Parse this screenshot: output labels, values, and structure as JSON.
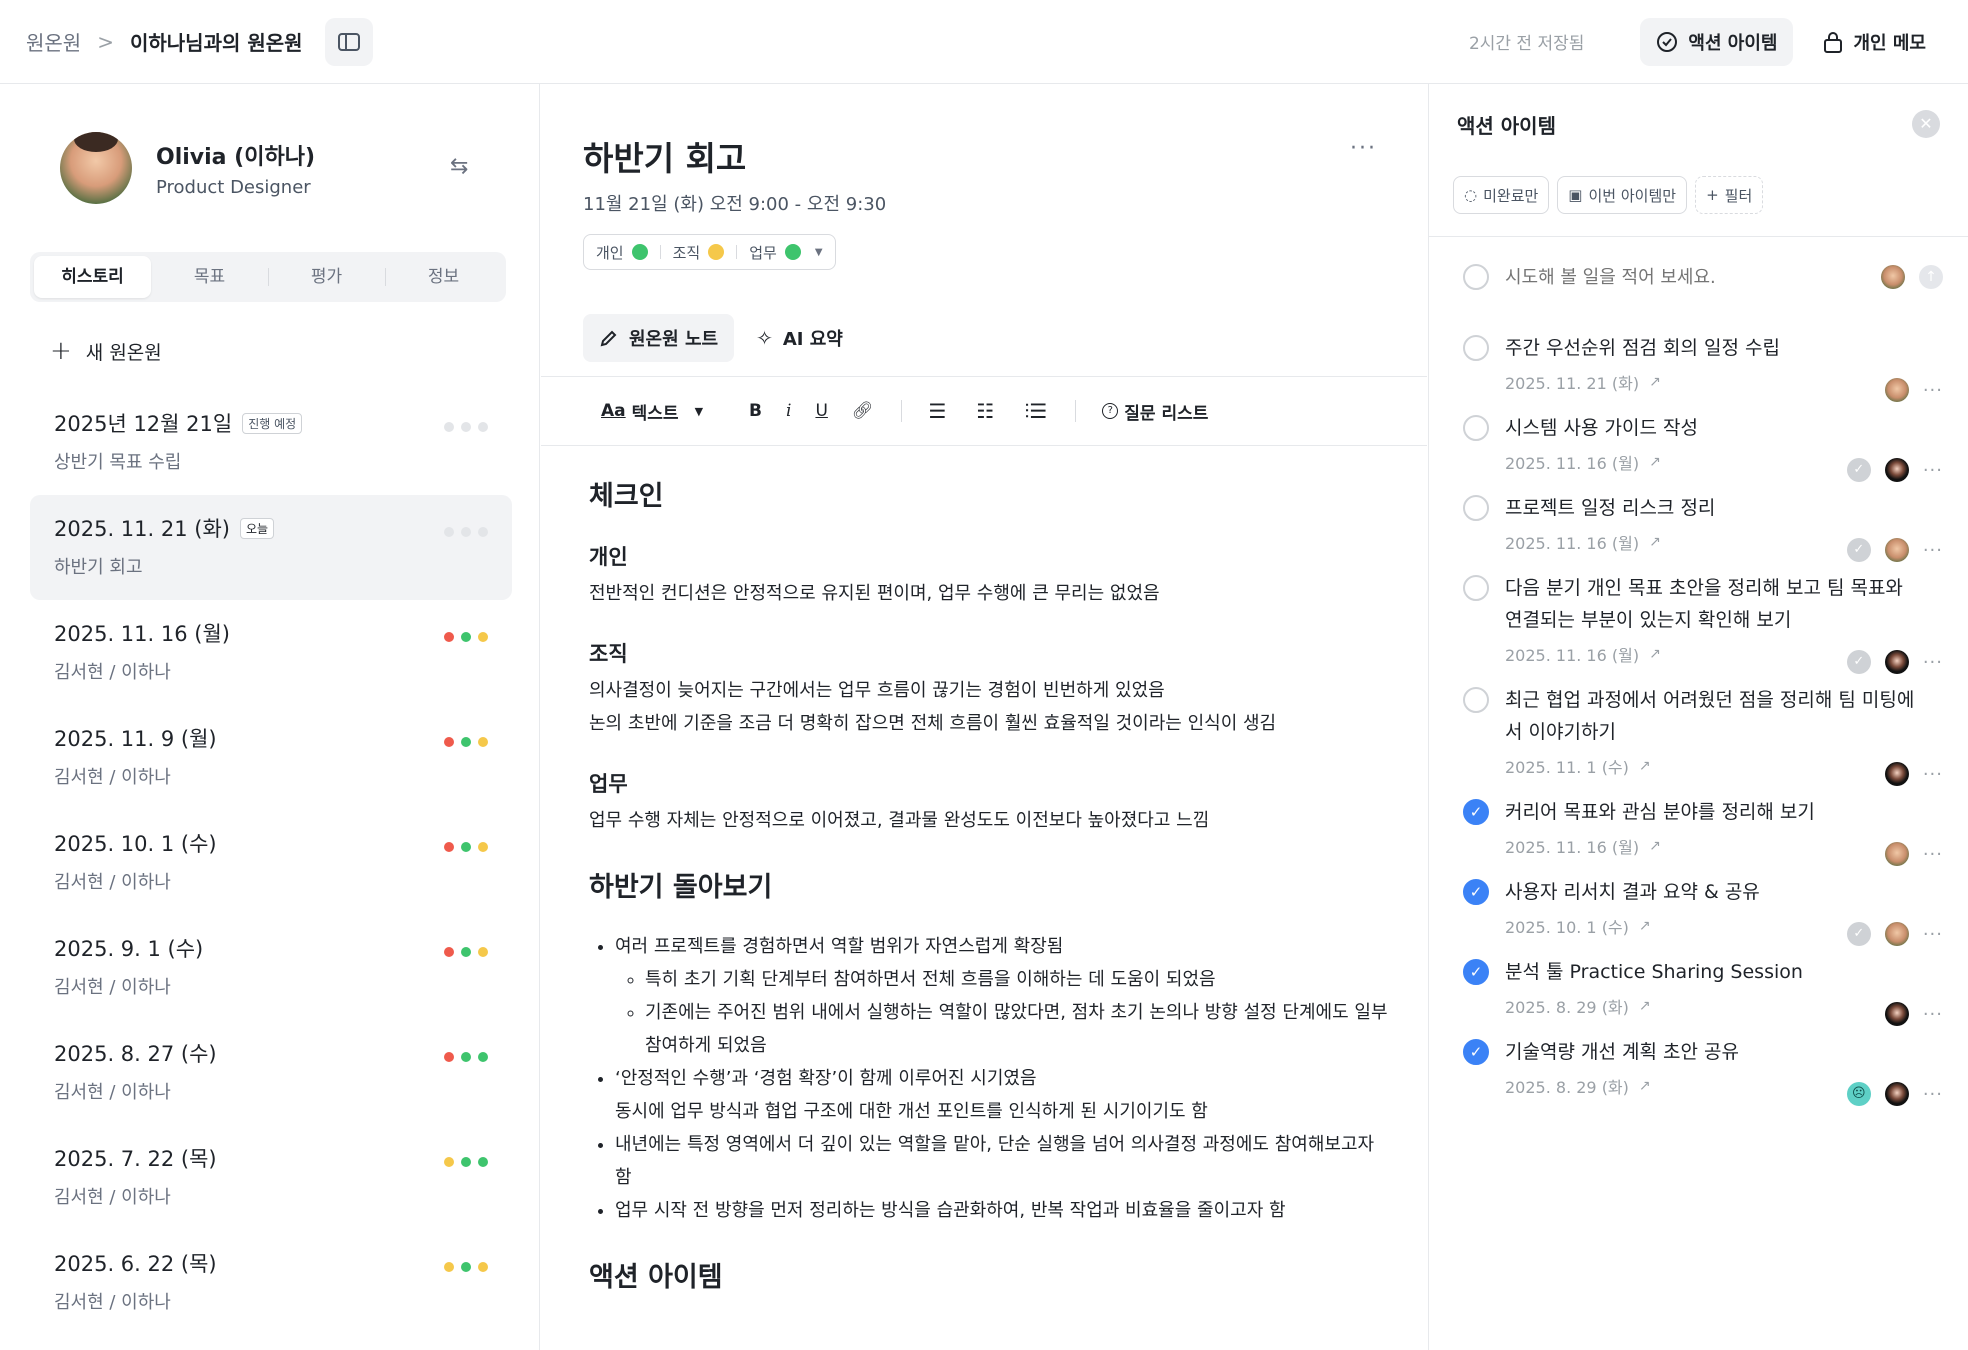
{
  "topbar": {
    "breadcrumb_root": "원온원",
    "breadcrumb_sep": ">",
    "breadcrumb_current": "이하나님과의 원온원",
    "saved_text": "2시간 전 저장됨",
    "action_items_btn": "액션 아이템",
    "private_memo_btn": "개인 메모"
  },
  "profile": {
    "name": "Olivia (이하나)",
    "role": "Product Designer"
  },
  "tabs": [
    "히스토리",
    "목표",
    "평가",
    "정보"
  ],
  "new_btn": "새 원온원",
  "status_colors": {
    "red": "#ef5a4c",
    "yellow": "#f5c84a",
    "green": "#3ec46d",
    "gray": "#e3e5e8"
  },
  "history": [
    {
      "date": "2025년 12월 21일",
      "badge": "진행 예정",
      "sub": "상반기 목표 수립",
      "dots": [
        "gray",
        "gray",
        "gray"
      ]
    },
    {
      "date": "2025. 11. 21 (화)",
      "badge": "오늘",
      "sub": "하반기 회고",
      "dots": [
        "gray",
        "gray",
        "gray"
      ],
      "selected": true
    },
    {
      "date": "2025. 11. 16 (월)",
      "badge": "",
      "sub": "김서현 / 이하나",
      "dots": [
        "red",
        "green",
        "yellow"
      ]
    },
    {
      "date": "2025. 11. 9 (월)",
      "badge": "",
      "sub": "김서현 / 이하나",
      "dots": [
        "red",
        "green",
        "yellow"
      ]
    },
    {
      "date": "2025. 10. 1 (수)",
      "badge": "",
      "sub": "김서현 / 이하나",
      "dots": [
        "red",
        "green",
        "yellow"
      ]
    },
    {
      "date": "2025. 9. 1 (수)",
      "badge": "",
      "sub": "김서현 / 이하나",
      "dots": [
        "red",
        "green",
        "yellow"
      ]
    },
    {
      "date": "2025. 8. 27 (수)",
      "badge": "",
      "sub": "김서현 / 이하나",
      "dots": [
        "red",
        "green",
        "green"
      ]
    },
    {
      "date": "2025. 7. 22 (목)",
      "badge": "",
      "sub": "김서현 / 이하나",
      "dots": [
        "yellow",
        "green",
        "green"
      ]
    },
    {
      "date": "2025. 6. 22 (목)",
      "badge": "",
      "sub": "김서현 / 이하나",
      "dots": [
        "yellow",
        "green",
        "yellow"
      ]
    }
  ],
  "meeting": {
    "title": "하반기 회고",
    "more": "···",
    "time": "11월 21일 (화) 오전 9:00 - 오전 9:30",
    "categories": [
      {
        "label": "개인",
        "color": "green"
      },
      {
        "label": "조직",
        "color": "yellow"
      },
      {
        "label": "업무",
        "color": "green"
      }
    ],
    "note_tab": "원온원 노트",
    "ai_tab": "AI 요약"
  },
  "toolbar": {
    "text_style": "텍스트",
    "text_icon": "Aa",
    "bold": "B",
    "italic": "i",
    "underline": "U",
    "question_list": "질문 리스트"
  },
  "doc": {
    "checkin_heading": "체크인",
    "sections": [
      {
        "title": "개인",
        "lines": [
          "전반적인 컨디션은 안정적으로 유지된 편이며, 업무 수행에 큰 무리는 없었음"
        ]
      },
      {
        "title": "조직",
        "lines": [
          "의사결정이 늦어지는 구간에서는 업무 흐름이 끊기는 경험이 빈번하게 있었음",
          "논의 초반에 기준을 조금 더 명확히 잡으면 전체 흐름이 훨씬 효율적일 것이라는 인식이 생김"
        ]
      },
      {
        "title": "업무",
        "lines": [
          "업무 수행 자체는 안정적으로 이어졌고, 결과물 완성도도 이전보다 높아졌다고 느낌"
        ]
      }
    ],
    "review_heading": "하반기 돌아보기",
    "bullets": [
      {
        "text": "여러 프로젝트를 경험하면서 역할 범위가 자연스럽게 확장됨",
        "sub": [
          "특히 초기 기획 단계부터 참여하면서 전체 흐름을 이해하는 데 도움이 되었음",
          "기존에는 주어진 범위 내에서 실행하는 역할이 많았다면, 점차 초기 논의나 방향 설정 단계에도 일부 참여하게 되었음"
        ]
      },
      {
        "text": "‘안정적인 수행’과 ‘경험 확장’이 함께 이루어진 시기였음",
        "cont": "동시에 업무 방식과 협업 구조에 대한 개선 포인트를 인식하게 된 시기이기도 함",
        "sub": []
      },
      {
        "text": "내년에는 특정 영역에서 더 깊이 있는 역할을 맡아, 단순 실행을 넘어 의사결정 과정에도 참여해보고자 함",
        "sub": []
      },
      {
        "text": "업무 시작 전 방향을 먼저 정리하는 방식을 습관화하여, 반복 작업과 비효율을 줄이고자 함",
        "sub": []
      }
    ],
    "action_heading": "액션 아이템"
  },
  "actions": {
    "title": "액션 아이템",
    "filters": [
      "미완료만",
      "이번 아이템만",
      "필터"
    ],
    "input_placeholder": "시도해 볼 일을 적어 보세요.",
    "items": [
      {
        "text": "주간 우선순위 점검 회의 일정 수립",
        "date": "2025. 11. 21 (화)",
        "done": false,
        "avatars": [
          "face"
        ]
      },
      {
        "text": "시스템 사용 가이드 작성",
        "date": "2025. 11. 16 (월)",
        "done": false,
        "avatars": [
          "gray",
          "dark"
        ]
      },
      {
        "text": "프로젝트 일정 리스크 정리",
        "date": "2025. 11. 16 (월)",
        "done": false,
        "avatars": [
          "gray",
          "face"
        ]
      },
      {
        "text": "다음 분기 개인 목표 초안을 정리해 보고 팀 목표와 연결되는 부분이 있는지 확인해 보기",
        "date": "2025. 11. 16 (월)",
        "done": false,
        "avatars": [
          "gray",
          "dark"
        ]
      },
      {
        "text": "최근 협업 과정에서 어려웠던 점을 정리해 팀 미팅에서 이야기하기",
        "date": "2025. 11. 1 (수)",
        "done": false,
        "avatars": [
          "dark"
        ]
      },
      {
        "text": "커리어 목표와 관심 분야를 정리해 보기",
        "date": "2025. 11. 16 (월)",
        "done": true,
        "avatars": [
          "face"
        ]
      },
      {
        "text": "사용자 리서치 결과 요약 & 공유",
        "date": "2025. 10. 1 (수)",
        "done": true,
        "avatars": [
          "gray",
          "face"
        ]
      },
      {
        "text": "분석 툴 Practice Sharing Session",
        "date": "2025. 8. 29 (화)",
        "done": true,
        "avatars": [
          "dark"
        ]
      },
      {
        "text": "기술역량 개선 계획 초안 공유",
        "date": "2025. 8. 29 (화)",
        "done": true,
        "avatars": [
          "mint",
          "dark"
        ]
      }
    ]
  }
}
